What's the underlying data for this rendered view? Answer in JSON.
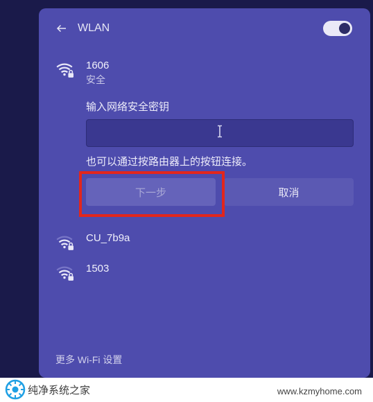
{
  "header": {
    "title": "WLAN",
    "toggle_on": true
  },
  "current_network": {
    "name": "1606",
    "status": "安全",
    "prompt": "输入网络安全密钥",
    "password_value": "",
    "hint": "也可以通过按路由器上的按钮连接。",
    "next_label": "下一步",
    "cancel_label": "取消"
  },
  "other_networks": [
    {
      "name": "CU_7b9a",
      "secured": true
    },
    {
      "name": "1503",
      "secured": true
    }
  ],
  "footer": {
    "more_settings": "更多 Wi-Fi 设置"
  },
  "watermark": {
    "brand": "纯净系统之家",
    "url": "www.kzmyhome.com"
  }
}
